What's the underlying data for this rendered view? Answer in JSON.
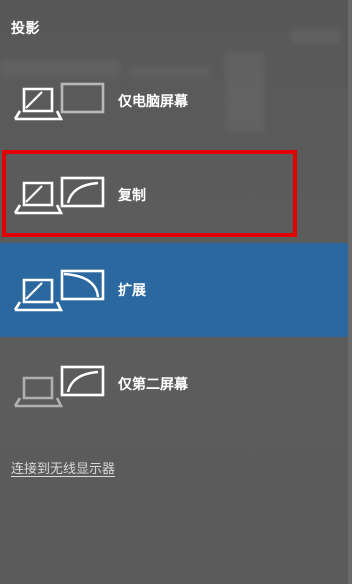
{
  "panel": {
    "title": "投影"
  },
  "options": [
    {
      "label": "仅电脑屏幕",
      "icon": "pc-screen-only-icon",
      "selected": false
    },
    {
      "label": "复制",
      "icon": "duplicate-icon",
      "selected": false
    },
    {
      "label": "扩展",
      "icon": "extend-icon",
      "selected": true
    },
    {
      "label": "仅第二屏幕",
      "icon": "second-screen-only-icon",
      "selected": false
    }
  ],
  "wireless_link": "连接到无线显示器",
  "colors": {
    "selected_background": "#2a689f",
    "highlight_border": "#e30000",
    "panel_background": "#5a5a5a"
  }
}
